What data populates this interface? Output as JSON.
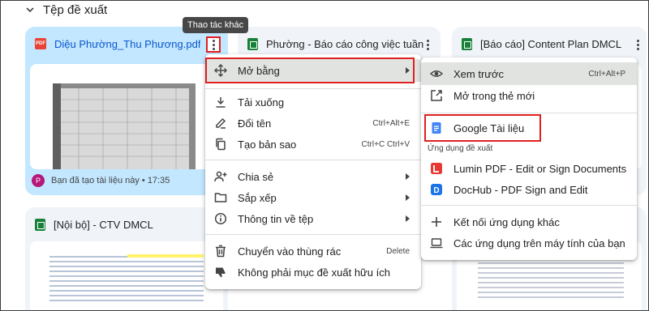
{
  "section": {
    "title": "Tệp đề xuất"
  },
  "tooltip": "Thao tác khác",
  "cards": [
    {
      "name": "Diệu Phường_Thu Phương.pdf",
      "footer": "Bạn đã tạo tài liệu này • 17:35",
      "avatar": "P"
    },
    {
      "name": "Phường - Báo cáo công việc tuần"
    },
    {
      "name": "[Báo cáo] Content Plan DMCL"
    },
    {
      "name": "[Nội bộ] - CTV DMCL"
    }
  ],
  "context_menu": {
    "items": [
      {
        "label": "Mở bằng",
        "icon": "open-with-icon"
      },
      {
        "label": "Tải xuống",
        "icon": "download-icon"
      },
      {
        "label": "Đổi tên",
        "shortcut": "Ctrl+Alt+E",
        "icon": "rename-icon"
      },
      {
        "label": "Tạo bản sao",
        "shortcut": "Ctrl+C Ctrl+V",
        "icon": "copy-icon"
      },
      {
        "label": "Chia sẻ",
        "icon": "share-icon"
      },
      {
        "label": "Sắp xếp",
        "icon": "folder-icon"
      },
      {
        "label": "Thông tin về tệp",
        "icon": "info-icon"
      },
      {
        "label": "Chuyển vào thùng rác",
        "shortcut": "Delete",
        "icon": "trash-icon"
      },
      {
        "label": "Không phải mục đề xuất hữu ích",
        "icon": "thumbs-down-icon"
      }
    ]
  },
  "submenu": {
    "preview": {
      "label": "Xem trước",
      "shortcut": "Ctrl+Alt+P"
    },
    "new_tab": {
      "label": "Mở trong thẻ mới"
    },
    "google_docs": {
      "label": "Google Tài liệu"
    },
    "suggested_label": "Ứng dụng đề xuất",
    "lumin": {
      "label": "Lumin PDF - Edit or Sign Documents"
    },
    "dochub": {
      "label": "DocHub - PDF Sign and Edit"
    },
    "connect": {
      "label": "Kết nối ứng dụng khác"
    },
    "desktop": {
      "label": "Các ứng dụng trên máy tính của bạn"
    }
  },
  "colors": {
    "selected_card": "#c2e7ff",
    "highlight": "#e02020",
    "sheets_green": "#188038",
    "docs_blue": "#4285f4"
  }
}
